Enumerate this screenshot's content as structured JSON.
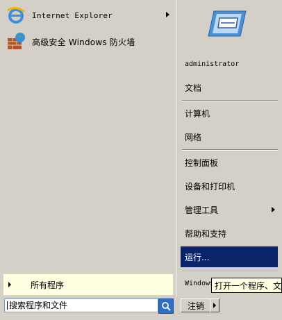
{
  "pinned": [
    {
      "label": "Internet Explorer",
      "icon": "internet-explorer-icon",
      "has_submenu": true
    },
    {
      "label": "高级安全 Windows 防火墙",
      "icon": "firewall-icon",
      "has_submenu": false
    }
  ],
  "all_programs": {
    "label": "所有程序"
  },
  "search": {
    "placeholder": "搜索程序和文件"
  },
  "right": {
    "user_name": "administrator",
    "documents": "文档",
    "computer": "计算机",
    "network": "网络",
    "control_panel": "控制面板",
    "devices_printers": "设备和打印机",
    "admin_tools": "管理工具",
    "help_support": "帮助和支持",
    "run": "运行...",
    "windows_security": "Windows"
  },
  "shutdown": {
    "label": "注销"
  },
  "tooltip": {
    "text": "打开一个程序、文"
  },
  "colors": {
    "menu_bg": "#d4d0c8",
    "selected_bg": "#0a246a",
    "tooltip_bg": "#ffffe1"
  }
}
